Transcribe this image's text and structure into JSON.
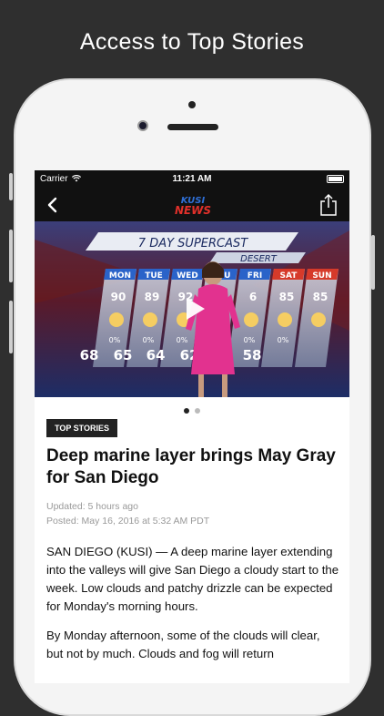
{
  "promo": {
    "title": "Access to Top Stories"
  },
  "status_bar": {
    "carrier": "Carrier",
    "time": "11:21 AM"
  },
  "nav": {
    "logo_top": "KUSI",
    "logo_bottom": "NEWS"
  },
  "video": {
    "banner_title": "7 DAY SUPERCAST",
    "region": "DESERT",
    "days": [
      "MON",
      "TUE",
      "WED",
      "THU",
      "FRI",
      "SAT",
      "SUN"
    ],
    "highs": [
      "90",
      "89",
      "92",
      "",
      "6",
      "85",
      "85"
    ],
    "precip": [
      "0%",
      "0%",
      "0%",
      "",
      "0%",
      "0%"
    ],
    "lows": [
      "68",
      "65",
      "64",
      "62",
      "58"
    ]
  },
  "pager": {
    "count": 2,
    "active": 0
  },
  "article": {
    "category": "TOP STORIES",
    "headline": "Deep marine layer brings May Gray for San Diego",
    "updated": "Updated: 5 hours ago",
    "posted": "Posted: May 16, 2016 at 5:32 AM PDT",
    "paragraphs": [
      "SAN DIEGO (KUSI) — A deep marine layer extending into the valleys will give San Diego a cloudy start to the week. Low clouds and patchy drizzle can be expected for Monday's morning hours.",
      "By Monday  afternoon, some of the clouds will clear, but not by much.  Clouds and fog will return"
    ]
  },
  "colors": {
    "background": "#2f2f2f",
    "bar": "#111111",
    "weekend_day": "#d63a2a",
    "weekday_day": "#2a63c9"
  }
}
